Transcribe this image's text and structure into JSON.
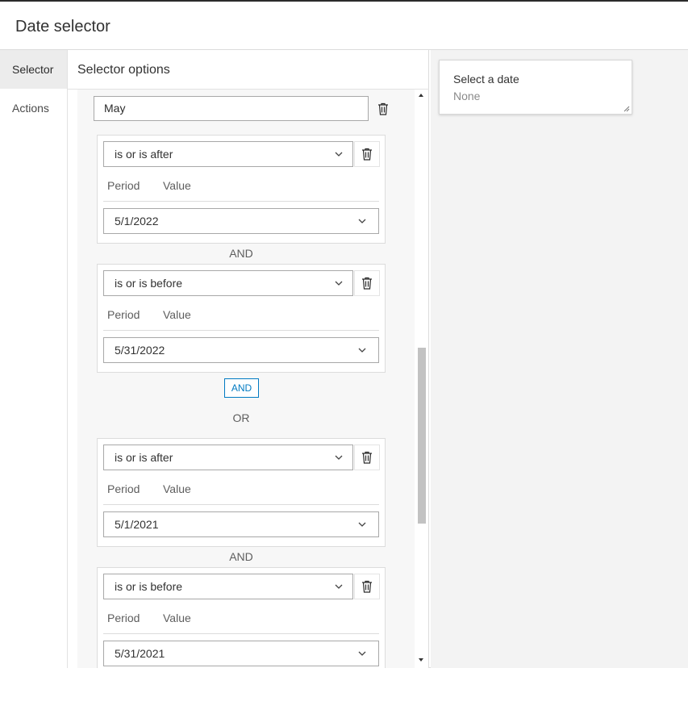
{
  "dialog": {
    "title": "Date selector"
  },
  "nav": {
    "items": [
      {
        "label": "Selector"
      },
      {
        "label": "Actions"
      }
    ]
  },
  "options": {
    "title": "Selector options",
    "name_value": "May"
  },
  "period_label": "Period",
  "value_label": "Value",
  "clauses": [
    {
      "operator": "is or is after",
      "value": "5/1/2022"
    },
    {
      "operator": "is or is before",
      "value": "5/31/2022"
    },
    {
      "operator": "is or is after",
      "value": "5/1/2021"
    },
    {
      "operator": "is or is before",
      "value": "5/31/2021"
    }
  ],
  "joins": {
    "and_1": "AND",
    "and_button": "AND",
    "or": "OR",
    "and_2": "AND"
  },
  "preview": {
    "label": "Select a date",
    "value": "None"
  },
  "icons": {
    "delete": "trash-icon",
    "dropdown": "chevron-down-icon",
    "scroll_up": "caret-up-icon",
    "scroll_down": "caret-down-icon"
  },
  "colors": {
    "accent": "#007ac2"
  }
}
